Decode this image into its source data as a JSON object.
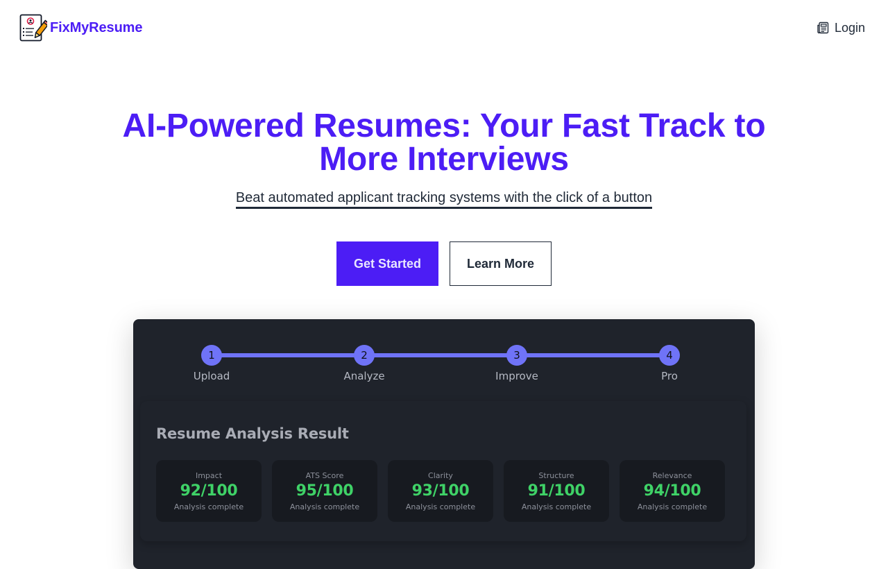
{
  "header": {
    "brand_name": "FixMyResume",
    "login_label": "Login"
  },
  "hero": {
    "title_line1": "AI-Powered Resumes: Your Fast Track to",
    "title_line2": "More Interviews",
    "subtitle": "Beat automated applicant tracking systems with the click of a button",
    "primary_cta": "Get Started",
    "secondary_cta": "Learn More"
  },
  "preview": {
    "steps": [
      {
        "number": "1",
        "label": "Upload"
      },
      {
        "number": "2",
        "label": "Analyze"
      },
      {
        "number": "3",
        "label": "Improve"
      },
      {
        "number": "4",
        "label": "Pro"
      }
    ],
    "result_title": "Resume Analysis Result",
    "metrics": [
      {
        "name": "Impact",
        "score": "92/100",
        "status": "Analysis complete"
      },
      {
        "name": "ATS Score",
        "score": "95/100",
        "status": "Analysis complete"
      },
      {
        "name": "Clarity",
        "score": "93/100",
        "status": "Analysis complete"
      },
      {
        "name": "Structure",
        "score": "91/100",
        "status": "Analysis complete"
      },
      {
        "name": "Relevance",
        "score": "94/100",
        "status": "Analysis complete"
      }
    ]
  },
  "colors": {
    "brand": "#4c1df5",
    "panel_bg": "#1f232b",
    "step_accent": "#6f73f7",
    "score_green": "#3fd267"
  },
  "icons": {
    "brand_logo": "resume-pencil-icon",
    "login_icon": "newspaper-icon"
  }
}
